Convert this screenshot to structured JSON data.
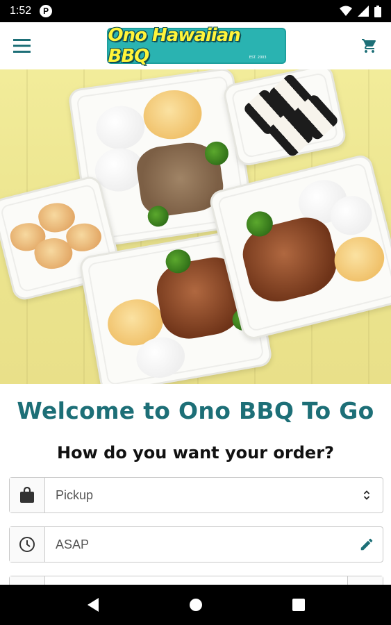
{
  "status_bar": {
    "time": "1:52",
    "notification_icon": "P"
  },
  "app_bar": {
    "logo_text": "Ono Hawaiian BBQ",
    "logo_est": "EST. 2003"
  },
  "welcome_title": "Welcome to Ono BBQ To Go",
  "order_question": "How do you want your order?",
  "order_type": {
    "selected": "Pickup",
    "icon": "shopping-bag-icon"
  },
  "order_time": {
    "value": "ASAP",
    "icon": "clock-icon"
  },
  "colors": {
    "brand_teal": "#2ab3b1",
    "title_teal": "#1d6f77",
    "logo_yellow": "#fff43a"
  }
}
